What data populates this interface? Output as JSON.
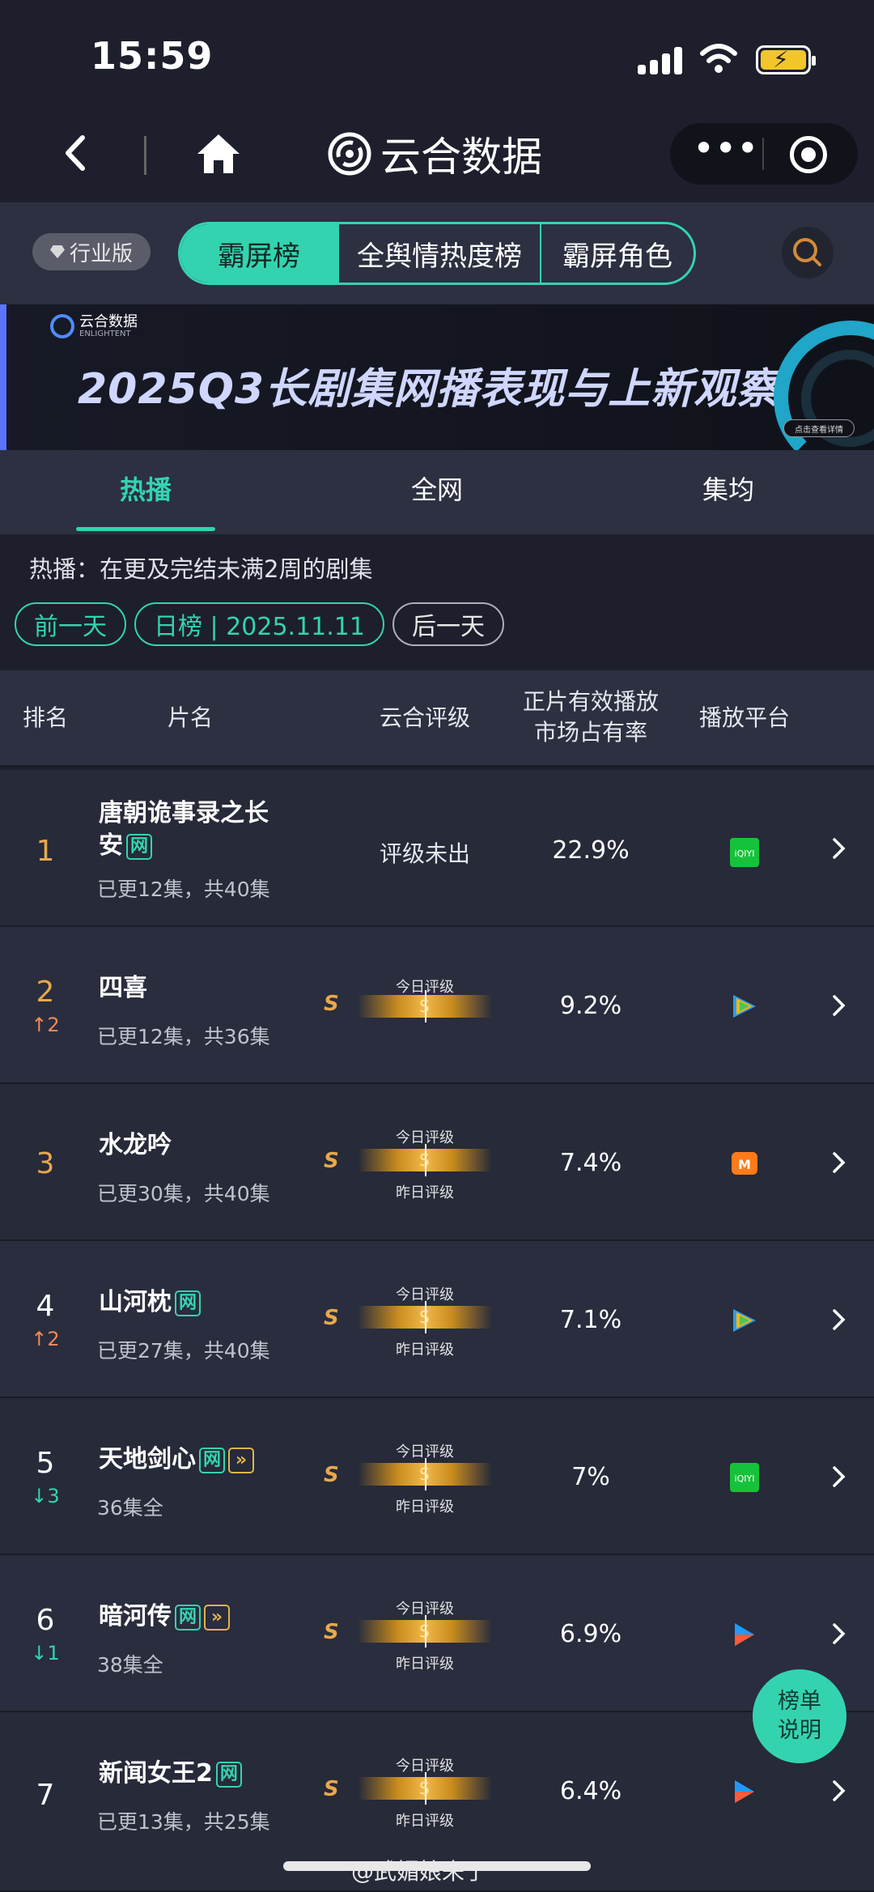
{
  "status": {
    "time": "15:59"
  },
  "nav": {
    "brand": "云合数据"
  },
  "topbar": {
    "edition": "行业版",
    "segments": [
      "霸屏榜",
      "全舆情热度榜",
      "霸屏角色"
    ],
    "active_segment": 0
  },
  "banner": {
    "logo_cn": "云合数据",
    "logo_en": "ENLIGHTENT",
    "headline": "2025Q3长剧集网播表现与上新观察",
    "cta": "点击查看详情"
  },
  "subtabs": [
    "热播",
    "全网",
    "集均"
  ],
  "description": "热播：在更及完结未满2周的剧集",
  "date_pills": {
    "prev": "前一天",
    "current": "日榜 | 2025.11.11",
    "next": "后一天"
  },
  "table_header": {
    "rank": "排名",
    "name": "片名",
    "grade": "云合评级",
    "share_line1": "正片有效播放",
    "share_line2": "市场占有率",
    "platform": "播放平台"
  },
  "grade_labels": {
    "today": "今日评级",
    "yesterday": "昨日评级"
  },
  "rows": [
    {
      "rank": "1",
      "change": "",
      "title_line1": "唐朝诡事录之长",
      "title_line2": "安",
      "tags": [
        "网"
      ],
      "episodes": "已更12集，共40集",
      "grade": "评级未出",
      "share": "22.9%",
      "platform_icon": "iqiyi-icon"
    },
    {
      "rank": "2",
      "change": "↑2",
      "title_line1": "四喜",
      "tags": [],
      "episodes": "已更12集，共36集",
      "grade_letter": "S",
      "bar_s": "S",
      "share": "9.2%",
      "platform_icon": "tencent-video-icon"
    },
    {
      "rank": "3",
      "change": "",
      "title_line1": "水龙吟",
      "tags": [],
      "episodes": "已更30集，共40集",
      "grade_letter": "S",
      "bar_s": "S",
      "share": "7.4%",
      "platform_icon": "mango-tv-icon"
    },
    {
      "rank": "4",
      "change": "↑2",
      "title_line1": "山河枕",
      "tags": [
        "网"
      ],
      "episodes": "已更27集，共40集",
      "grade_letter": "S",
      "bar_s": "S",
      "share": "7.1%",
      "platform_icon": "tencent-video-icon"
    },
    {
      "rank": "5",
      "change": "↓3",
      "title_line1": "天地剑心",
      "tags": [
        "网",
        "»"
      ],
      "episodes": "36集全",
      "grade_letter": "S",
      "bar_s": "S",
      "share": "7%",
      "platform_icon": "iqiyi-icon"
    },
    {
      "rank": "6",
      "change": "↓1",
      "title_line1": "暗河传",
      "tags": [
        "网",
        "»"
      ],
      "episodes": "38集全",
      "grade_letter": "S",
      "bar_s": "S",
      "share": "6.9%",
      "platform_icon": "youku-icon"
    },
    {
      "rank": "7",
      "change": "",
      "title_line1": "新闻女王2",
      "tags": [
        "网"
      ],
      "episodes": "已更13集，共25集",
      "grade_letter": "S",
      "bar_s": "S",
      "share": "6.4%",
      "platform_icon": "youku-icon"
    }
  ],
  "fab": {
    "line1": "榜单",
    "line2": "说明"
  },
  "watermark": "@武媚娘来了",
  "colors": {
    "accent": "#34d3b0",
    "up": "#f08a5a",
    "rank_gold": "#e8a84c"
  }
}
